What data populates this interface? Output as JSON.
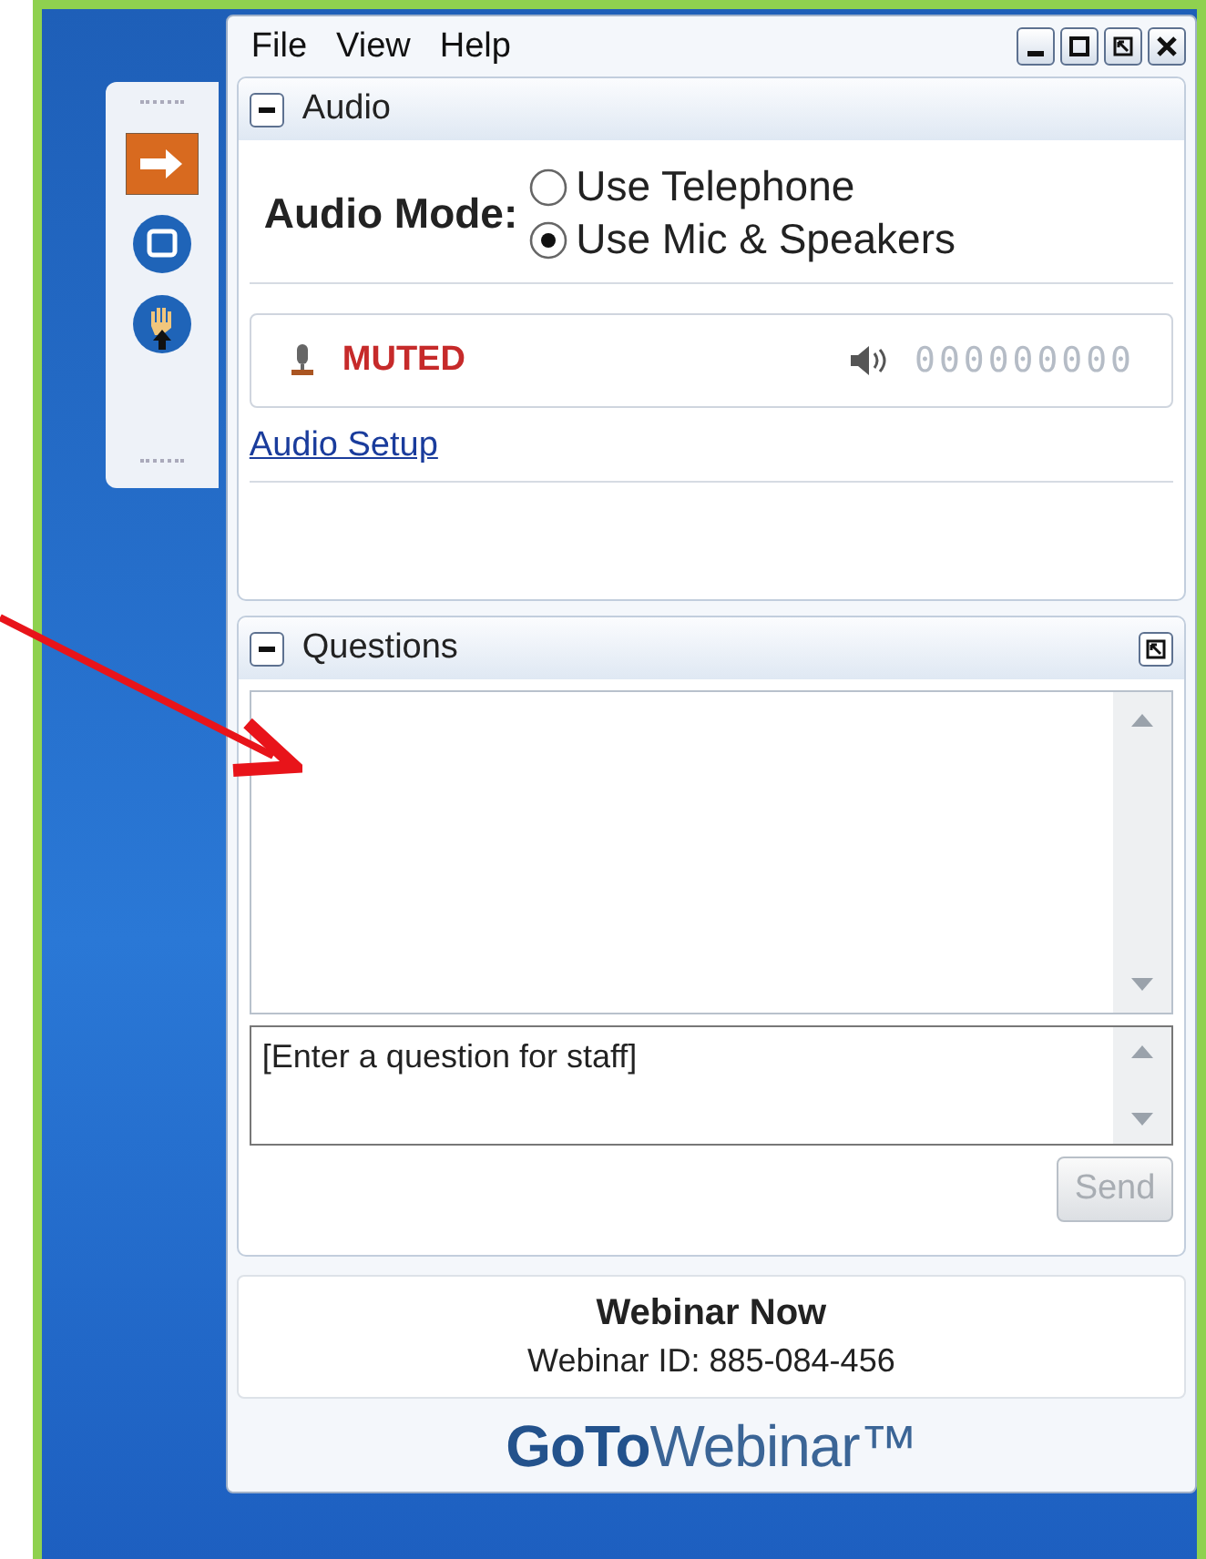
{
  "menu": [
    "File",
    "View",
    "Help"
  ],
  "audio": {
    "title": "Audio",
    "mode_label": "Audio Mode:",
    "options": [
      {
        "label": "Use Telephone",
        "selected": false
      },
      {
        "label": "Use Mic & Speakers",
        "selected": true
      }
    ],
    "mic_status": "MUTED",
    "speaker_reading": "000000000",
    "setup_link": "Audio Setup"
  },
  "questions": {
    "title": "Questions",
    "input": {
      "placeholder": "[Enter a question for staff]"
    },
    "send": {
      "label": "Send",
      "disabled": true
    }
  },
  "webinar": {
    "name": "Webinar Now",
    "id_line": "Webinar ID: 885-084-456"
  },
  "logo": "**GoTo**Webinar™"
}
